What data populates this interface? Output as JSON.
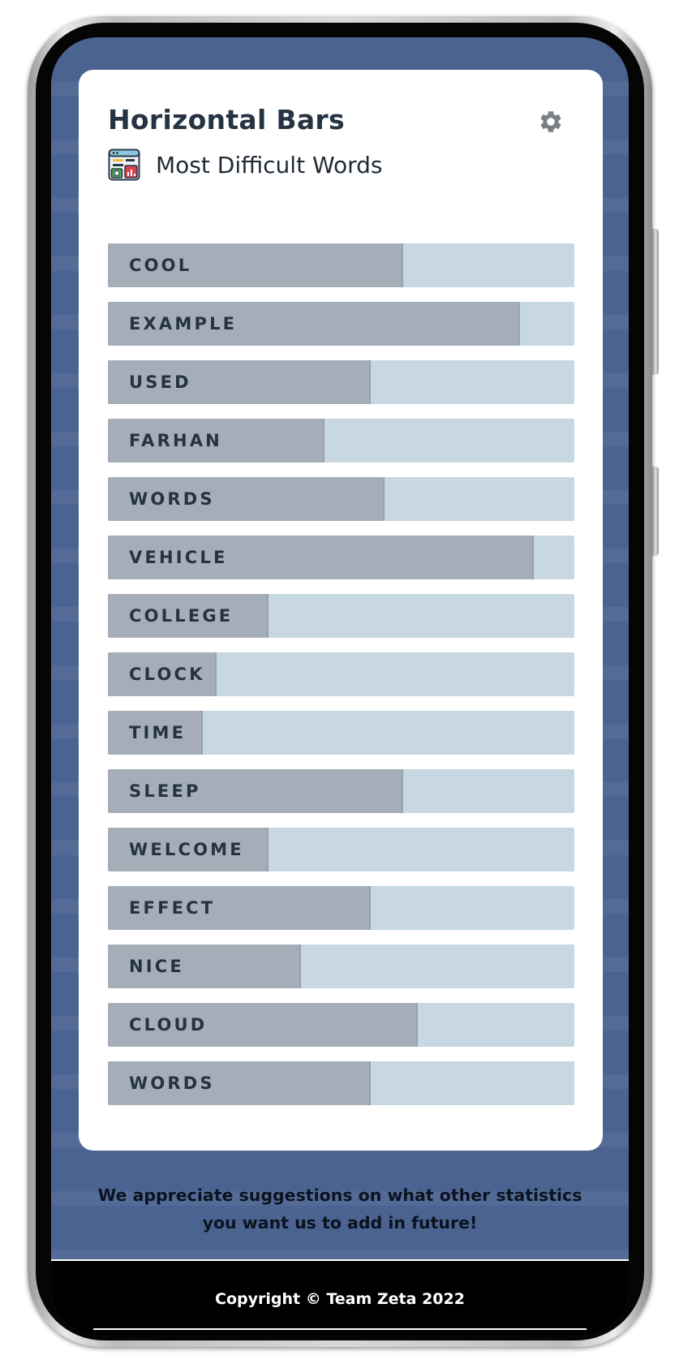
{
  "header": {
    "title": "Horizontal Bars",
    "subtitle": "Most Difficult Words",
    "settings_icon": "gear-icon",
    "subtitle_icon": "dashboard-stats-icon"
  },
  "chart_data": {
    "type": "bar",
    "orientation": "horizontal",
    "title": "Most Difficult Words",
    "categories": [
      "COOL",
      "EXAMPLE",
      "USED",
      "FARHAN",
      "WORDS",
      "VEHICLE",
      "COLLEGE",
      "CLOCK",
      "TIME",
      "SLEEP",
      "WELCOME",
      "EFFECT",
      "NICE",
      "CLOUD",
      "WORDS"
    ],
    "values": [
      0.63,
      0.88,
      0.56,
      0.46,
      0.59,
      0.91,
      0.34,
      0.23,
      0.2,
      0.63,
      0.34,
      0.56,
      0.41,
      0.66,
      0.56
    ],
    "value_unit": "fraction of bar",
    "xlim": [
      0,
      1
    ],
    "colors": {
      "fill": "#a5aeb8",
      "track": "#c8d8e2"
    }
  },
  "footnote": "We appreciate suggestions on what other statistics you want us to add in future!",
  "footer": {
    "copyright": "Copyright © Team Zeta 2022"
  },
  "colors": {
    "background": "#4a6390",
    "card": "#ffffff",
    "title": "#253342"
  }
}
